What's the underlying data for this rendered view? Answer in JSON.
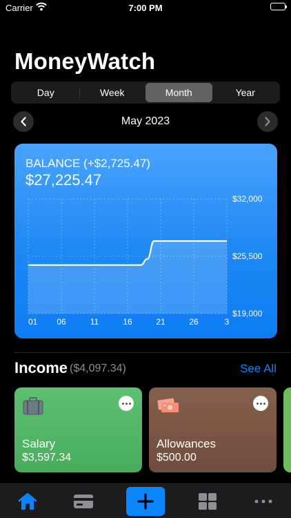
{
  "status_bar": {
    "carrier": "Carrier",
    "time": "7:00 PM"
  },
  "app_title": "MoneyWatch",
  "period_tabs": [
    {
      "label": "Day",
      "selected": false
    },
    {
      "label": "Week",
      "selected": false
    },
    {
      "label": "Month",
      "selected": true
    },
    {
      "label": "Year",
      "selected": false
    }
  ],
  "month_nav": {
    "label": "May 2023",
    "prev_icon": "chevron-left-icon",
    "next_icon": "chevron-right-icon"
  },
  "balance": {
    "label": "BALANCE (+$2,725.47)",
    "value": "$27,225.47"
  },
  "chart_data": {
    "type": "area",
    "x_ticks": [
      "01",
      "06",
      "11",
      "16",
      "21",
      "26",
      "3"
    ],
    "y_ticks": [
      "$32,000",
      "$25,500",
      "$19,000"
    ],
    "ylim": [
      19000,
      32000
    ],
    "xlim": [
      1,
      31
    ],
    "x": [
      1,
      18,
      19,
      20,
      31
    ],
    "y": [
      24500,
      24500,
      25200,
      27225,
      27225
    ],
    "colors": {
      "line": "#ffffff",
      "fill": "rgba(255,255,255,0.18)",
      "grid": "rgba(255,255,255,0.35)"
    }
  },
  "income": {
    "title": "Income",
    "total": "($4,097.34)",
    "see_all": "See All",
    "cards": [
      {
        "name": "Salary",
        "amount": "$3,597.34",
        "icon": "briefcase-icon",
        "color": "#52b766"
      },
      {
        "name": "Allowances",
        "amount": "$500.00",
        "icon": "cash-icon",
        "color": "#7a5646"
      }
    ]
  },
  "tab_bar": {
    "items": [
      {
        "name": "home-icon",
        "active": true
      },
      {
        "name": "card-icon",
        "active": false
      },
      {
        "name": "add-icon",
        "active": false
      },
      {
        "name": "grid-icon",
        "active": false
      },
      {
        "name": "more-icon",
        "active": false
      }
    ],
    "accent": "#0a84ff"
  }
}
